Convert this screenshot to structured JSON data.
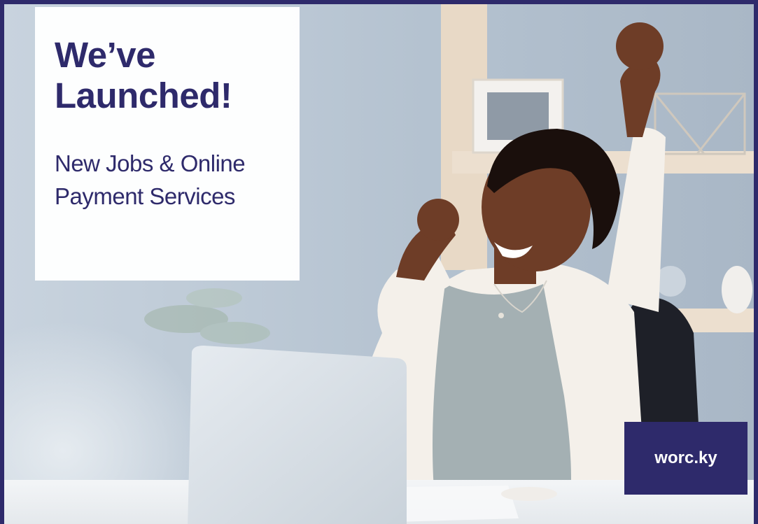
{
  "headline": {
    "title": "We’ve Launched!",
    "subtitle": "New Jobs & Online Payment Services"
  },
  "brand": {
    "label": "worc.ky"
  },
  "photo": {
    "subject": "woman celebrating at desk with raised fists"
  },
  "colors": {
    "brand_navy": "#2e2a6b",
    "card_white": "#ffffff"
  }
}
